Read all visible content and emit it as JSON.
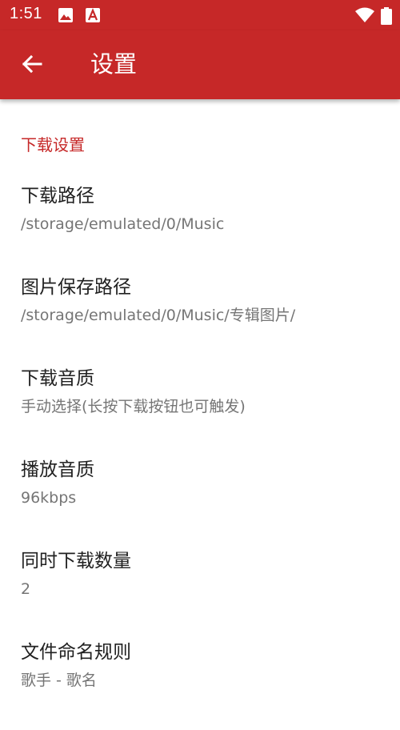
{
  "status_bar": {
    "time": "1:51",
    "icons": [
      "image-icon",
      "font-app-icon",
      "wifi-icon",
      "battery-icon"
    ]
  },
  "app_bar": {
    "back_icon": "arrow-left-icon",
    "title": "设置"
  },
  "settings": {
    "category": "下载设置",
    "items": [
      {
        "title": "下载路径",
        "summary": "/storage/emulated/0/Music"
      },
      {
        "title": "图片保存路径",
        "summary": "/storage/emulated/0/Music/专辑图片/"
      },
      {
        "title": "下载音质",
        "summary": "手动选择(长按下载按钮也可触发)"
      },
      {
        "title": "播放音质",
        "summary": "96kbps"
      },
      {
        "title": "同时下载数量",
        "summary": "2"
      },
      {
        "title": "文件命名规则",
        "summary": "歌手 - 歌名"
      }
    ]
  },
  "colors": {
    "primary": "#c62828",
    "title_text": "#212121",
    "summary_text": "#757575"
  }
}
